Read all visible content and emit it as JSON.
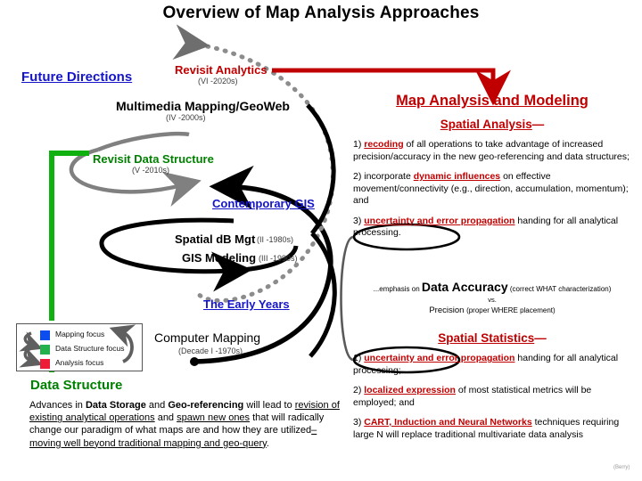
{
  "title": "Overview of Map Analysis Approaches",
  "credit": "(Berry)",
  "colors": {
    "red": "#c00000",
    "blue": "#1414c8",
    "green": "#008000",
    "gray": "#808080",
    "black": "#000000",
    "swatch_mapping": "#0c4df0",
    "swatch_data_structure": "#22b14c",
    "swatch_analysis": "#ed1c38"
  },
  "diagram": {
    "future_directions": "Future Directions",
    "revisit_analytics": "Revisit Analytics",
    "revisit_analytics_sub": "(VI -2020s)",
    "multimedia": "Multimedia Mapping/GeoWeb",
    "multimedia_sub": "(IV -2000s)",
    "revisit_data_structure": "Revisit Data Structure",
    "revisit_data_structure_sub": "(V -2010s)",
    "contemporary_gis": "Contemporary GIS",
    "spatial_db": "Spatial dB Mgt",
    "spatial_db_sub": "(II -1980s)",
    "gis_modeling": "GIS Modeling",
    "gis_modeling_sub": "(III -1990s)",
    "early_years": "The Early Years",
    "computer_mapping": "Computer Mapping",
    "computer_mapping_sub": "(Decade I -1970s)",
    "data_structure_heading": "Data Structure",
    "legend": [
      {
        "label": "Mapping focus",
        "color": "#0c4df0"
      },
      {
        "label": "Data Structure focus",
        "color": "#22b14c"
      },
      {
        "label": "Analysis focus",
        "color": "#ed1c38"
      }
    ],
    "data_structure_paragraph_html": "Advances in <b>Data Storage</b> and <b>Geo-referencing</b> will lead to <u>revision of existing analytical operations</u> and <u>spawn new ones</u> that will radically change our paradigm of what maps are and how they are utilized<u>– moving well beyond traditional mapping and geo-query</u>."
  },
  "right_panel": {
    "heading": "Map Analysis and Modeling",
    "spatial_analysis_heading": "Spatial Analysis",
    "spatial_analysis_dash": "—",
    "spatial_analysis_items_html": [
      "1) <span class=\"k\">recoding</span> of all operations to take advantage of increased precision/accuracy in the new geo-referencing and data structures;",
      "2) incorporate <span class=\"k\">dynamic influences</span> on effective movement/connectivity (e.g., direction, accumulation, momentum); and",
      "3) <span class=\"k\">uncertainty and error propagation</span> handing for all analytical processing."
    ],
    "accuracy": {
      "prefix": "...emphasis on",
      "term": "Data Accuracy",
      "paren": "(correct WHAT characterization)",
      "vs": "vs.",
      "precision": "Precision",
      "precision_paren": "(proper WHERE placement)"
    },
    "spatial_statistics_heading": "Spatial Statistics",
    "spatial_statistics_dash": "—",
    "spatial_statistics_items_html": [
      "1) <span class=\"k\">uncertainty and error propagation</span> handing for all analytical processing;",
      "2) <span class=\"k\">localized expression</span> of most statistical metrics will be employed; and",
      "3) <span class=\"k\">CART, Induction and Neural Networks</span> techniques requiring large N will replace traditional multivariate data analysis"
    ]
  }
}
